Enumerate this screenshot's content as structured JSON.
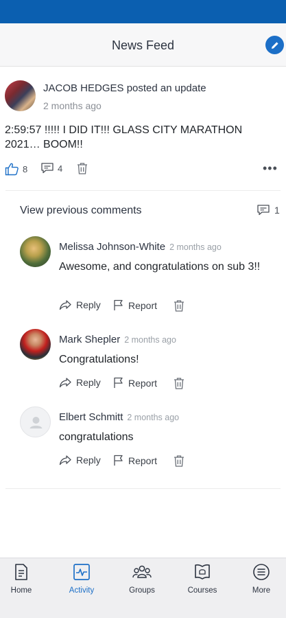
{
  "header": {
    "title": "News Feed",
    "compose_icon": "pencil-icon"
  },
  "post": {
    "author_line": "JACOB HEDGES posted an update",
    "time": "2 months ago",
    "text": "2:59:57 !!!!!   I DID IT!!!  GLASS CITY  MARATHON 2021… BOOM!!",
    "likes": "8",
    "comments": "4"
  },
  "comments_section": {
    "view_previous": "View previous comments",
    "count": "1",
    "items": [
      {
        "name": "Melissa Johnson-White",
        "time": "2 months ago",
        "text": "Awesome, and congratulations on sub 3!!"
      },
      {
        "name": "Mark Shepler",
        "time": "2 months ago",
        "text": "Congratulations!"
      },
      {
        "name": "Elbert Schmitt",
        "time": "2 months ago",
        "text": "congratulations"
      }
    ],
    "reply_label": "Reply",
    "report_label": "Report"
  },
  "tabs": [
    {
      "label": "Home",
      "icon": "document-icon"
    },
    {
      "label": "Activity",
      "icon": "activity-icon",
      "active": true
    },
    {
      "label": "Groups",
      "icon": "groups-icon"
    },
    {
      "label": "Courses",
      "icon": "courses-icon"
    },
    {
      "label": "More",
      "icon": "menu-icon"
    }
  ],
  "colors": {
    "statusbar": "#0b5fb0",
    "accent": "#1c6fc7"
  }
}
